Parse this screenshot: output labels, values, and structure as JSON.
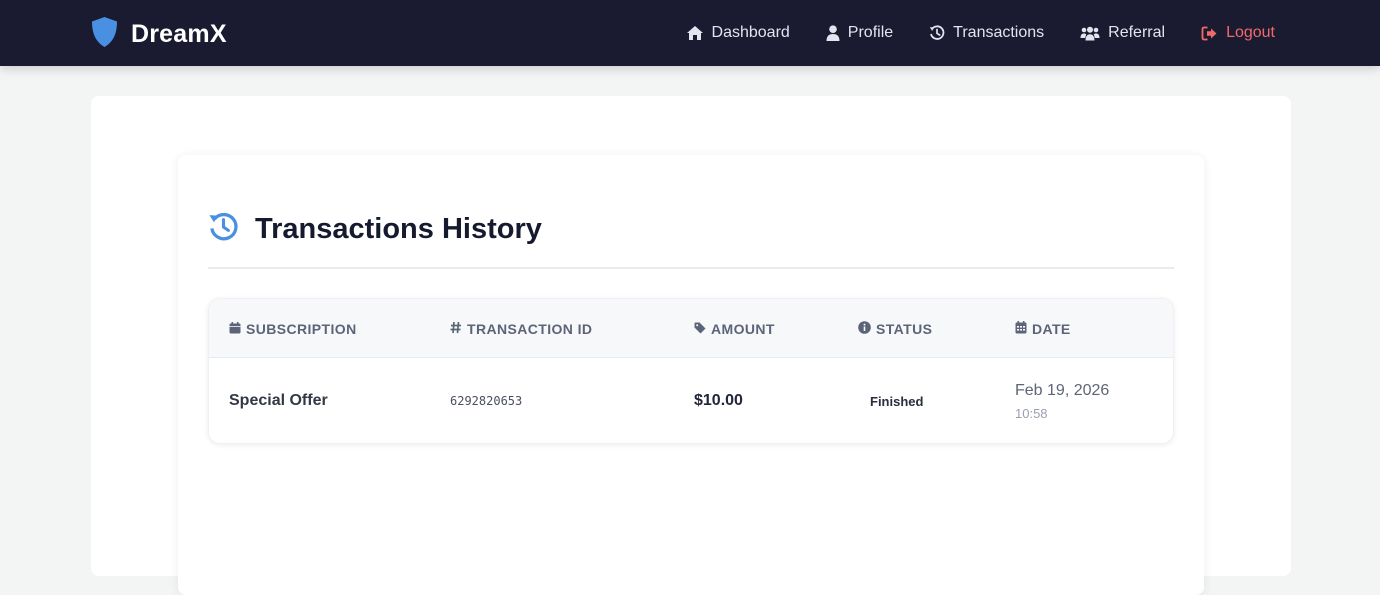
{
  "brand": {
    "name": "DreamX"
  },
  "nav": {
    "items": [
      {
        "label": "Dashboard",
        "icon": "home-icon"
      },
      {
        "label": "Profile",
        "icon": "user-icon"
      },
      {
        "label": "Transactions",
        "icon": "history-icon"
      },
      {
        "label": "Referral",
        "icon": "users-icon"
      },
      {
        "label": "Logout",
        "icon": "sign-out-icon",
        "color": "#f06a6a"
      }
    ]
  },
  "colors": {
    "navbar": "#1a1b30",
    "accent": "#4a90e2",
    "logout": "#f06a6a"
  },
  "page": {
    "title": "Transactions History"
  },
  "table": {
    "columns": [
      {
        "label": "SUBSCRIPTION",
        "icon": "calendar-icon"
      },
      {
        "label": "TRANSACTION ID",
        "icon": "hash-icon"
      },
      {
        "label": "AMOUNT",
        "icon": "tag-icon"
      },
      {
        "label": "STATUS",
        "icon": "info-icon"
      },
      {
        "label": "DATE",
        "icon": "calendar-grid-icon"
      }
    ],
    "rows": [
      {
        "subscription": "Special Offer",
        "transaction_id": "6292820653",
        "amount": "$10.00",
        "status": "Finished",
        "date": "Feb 19, 2026",
        "time": "10:58"
      }
    ]
  }
}
